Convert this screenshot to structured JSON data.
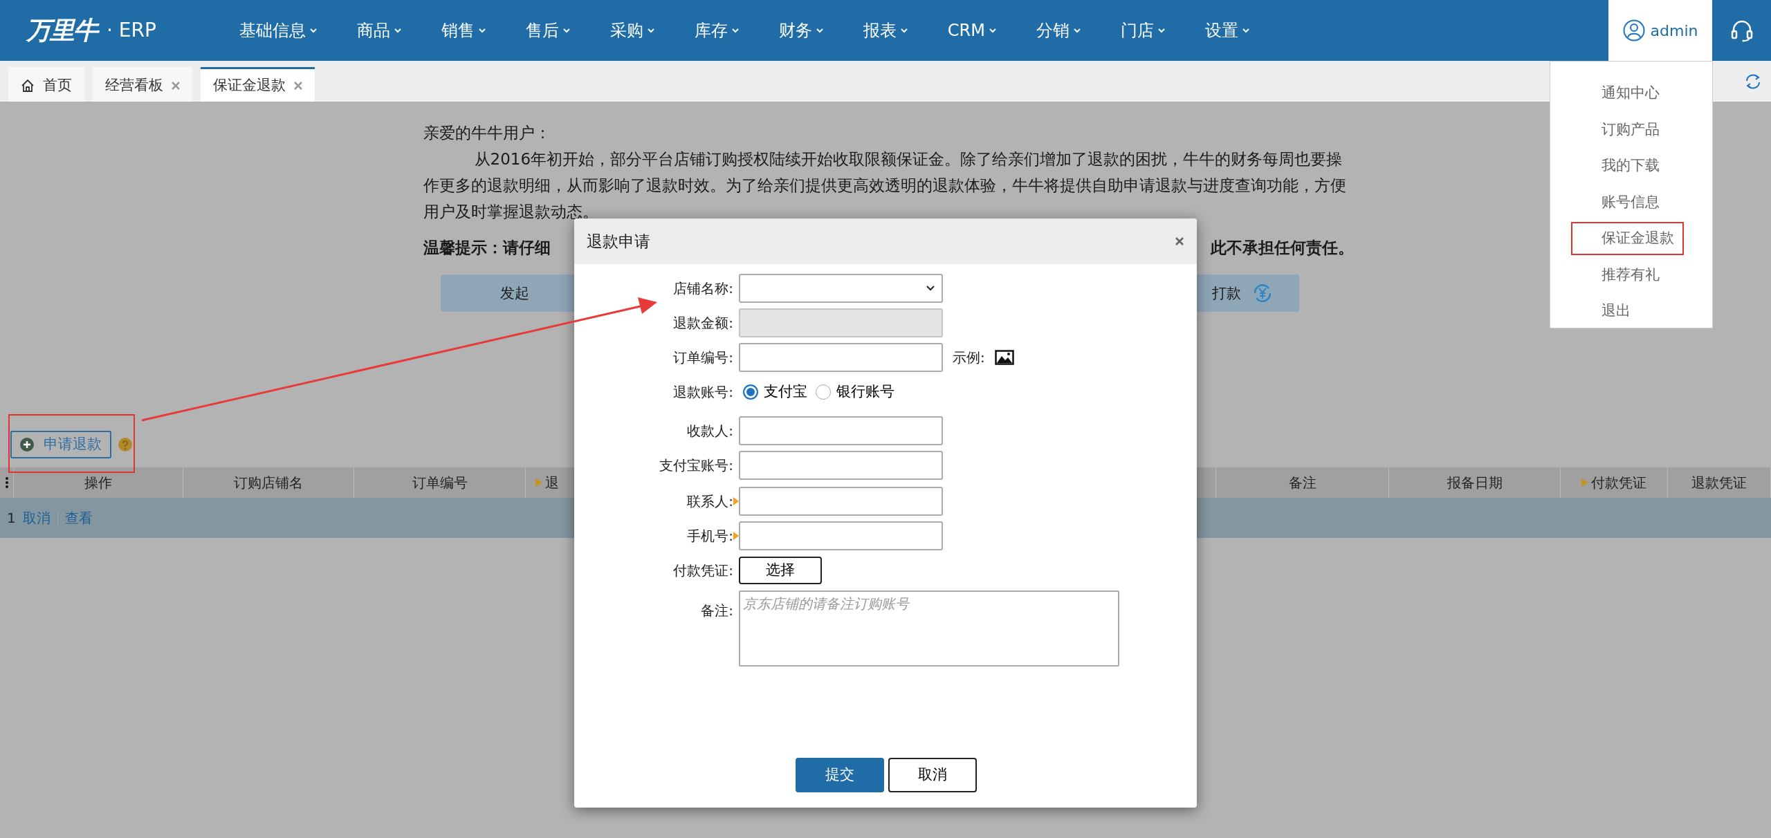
{
  "header": {
    "logo": "万里牛",
    "logo_suffix": "· ERP",
    "nav": [
      {
        "label": "基础信息"
      },
      {
        "label": "商品"
      },
      {
        "label": "销售"
      },
      {
        "label": "售后"
      },
      {
        "label": "采购"
      },
      {
        "label": "库存"
      },
      {
        "label": "财务"
      },
      {
        "label": "报表"
      },
      {
        "label": "CRM"
      },
      {
        "label": "分销"
      },
      {
        "label": "门店"
      },
      {
        "label": "设置"
      }
    ],
    "user": "admin"
  },
  "tabs": [
    {
      "label": "首页",
      "kind": "home",
      "selected": false
    },
    {
      "label": "经营看板",
      "kind": "closable",
      "selected": false
    },
    {
      "label": "保证金退款",
      "kind": "closable",
      "selected": true
    }
  ],
  "user_menu": [
    {
      "label": "通知中心",
      "highlighted": false
    },
    {
      "label": "订购产品",
      "highlighted": false
    },
    {
      "label": "我的下载",
      "highlighted": false
    },
    {
      "label": "账号信息",
      "highlighted": false
    },
    {
      "label": "保证金退款",
      "highlighted": true
    },
    {
      "label": "推荐有礼",
      "highlighted": false
    },
    {
      "label": "退出",
      "highlighted": false
    }
  ],
  "notice": {
    "greeting": "亲爱的牛牛用户：",
    "body": "从2016年初开始，部分平台店铺订购授权陆续开始收取限额保证金。除了给亲们增加了退款的困扰，牛牛的财务每周也要操作更多的退款明细，从而影响了退款时效。为了给亲们提供更高效透明的退款体验，牛牛将提供自助申请退款与进度查询功能，方便用户及时掌握退款动态。",
    "tip_left": "温馨提示：请仔细",
    "tip_right": "此不承担任何责任。",
    "action_left": "发起",
    "action_right": "打款"
  },
  "toolbar": {
    "apply_button": "申请退款",
    "highlighted": true
  },
  "table": {
    "columns": [
      {
        "label": "操作",
        "marker": false
      },
      {
        "label": "订购店铺名",
        "marker": false
      },
      {
        "label": "订单编号",
        "marker": false
      },
      {
        "label": "退",
        "marker": true
      },
      {
        "label": "备注",
        "marker": false
      },
      {
        "label": "报备日期",
        "marker": false
      },
      {
        "label": "付款凭证",
        "marker": true
      },
      {
        "label": "退款凭证",
        "marker": false
      }
    ],
    "rows": [
      {
        "index": "1",
        "actions": [
          "取消",
          "查看"
        ]
      }
    ]
  },
  "dialog": {
    "title": "退款申请",
    "fields": [
      {
        "kind": "select",
        "label": "店铺名称:",
        "required": false
      },
      {
        "kind": "text",
        "label": "退款金额:",
        "required": false,
        "disabled": true
      },
      {
        "kind": "text",
        "label": "订单编号:",
        "required": false,
        "disabled": false,
        "extra": "示例:"
      },
      {
        "kind": "radio",
        "label": "退款账号:",
        "required": false,
        "options": [
          {
            "label": "支付宝",
            "selected": true
          },
          {
            "label": "银行账号",
            "selected": false
          }
        ]
      },
      {
        "kind": "text",
        "label": "收款人:",
        "required": false,
        "disabled": false
      },
      {
        "kind": "text",
        "label": "支付宝账号:",
        "required": false,
        "disabled": false
      },
      {
        "kind": "text",
        "label": "联系人:",
        "required": true,
        "disabled": false
      },
      {
        "kind": "text",
        "label": "手机号:",
        "required": true,
        "disabled": false
      },
      {
        "kind": "file",
        "label": "付款凭证:",
        "required": false,
        "button": "选择"
      },
      {
        "kind": "textarea",
        "label": "备注:",
        "required": false,
        "placeholder": "京东店铺的请备注订购账号"
      }
    ],
    "buttons": [
      {
        "label": "提交",
        "primary": true
      },
      {
        "label": "取消",
        "primary": false
      }
    ]
  },
  "annotation": {
    "arrow": true
  }
}
